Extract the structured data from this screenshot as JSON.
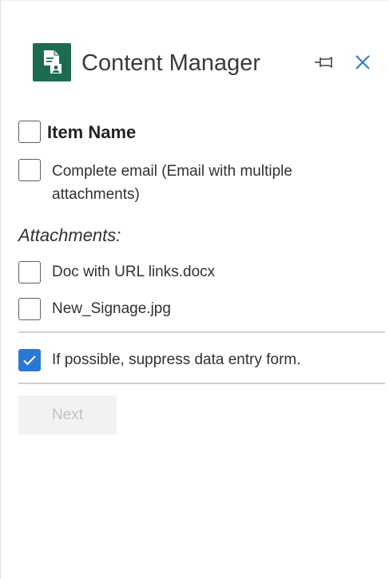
{
  "header": {
    "title": "Content Manager",
    "logo_icon": "content-manager-logo-icon",
    "pin_icon": "pin-icon",
    "close_icon": "close-icon"
  },
  "item": {
    "header_label": "Item Name",
    "header_checked": false,
    "email_label": "Complete email (Email with multiple attachments)",
    "email_checked": false
  },
  "attachments": {
    "title": "Attachments:",
    "items": [
      {
        "label": "Doc with URL links.docx",
        "checked": false
      },
      {
        "label": "New_Signage.jpg",
        "checked": false
      }
    ]
  },
  "options": {
    "suppress_label": "If possible, suppress data entry form.",
    "suppress_checked": true
  },
  "actions": {
    "next_label": "Next",
    "next_enabled": false
  },
  "colors": {
    "brand": "#1e6b53",
    "accent": "#2b78d4",
    "disabled_bg": "#f3f2f1",
    "disabled_text": "#c4c3c2"
  }
}
